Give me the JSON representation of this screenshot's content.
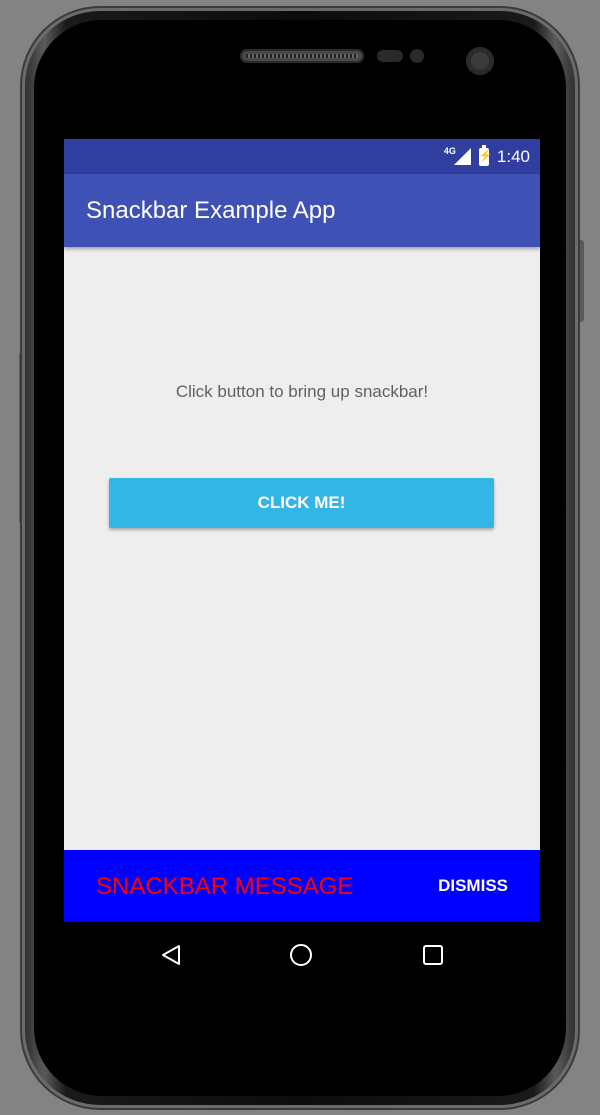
{
  "status_bar": {
    "network": "4G",
    "time": "1:40",
    "background_color": "#303F9F"
  },
  "app_bar": {
    "title": "Snackbar Example App",
    "background_color": "#3F51B5"
  },
  "content": {
    "prompt_text": "Click button to bring up snackbar!",
    "button_label": "CLICK ME!",
    "button_color": "#33B5E5",
    "background_color": "#EEEEEE"
  },
  "snackbar": {
    "message": "SNACKBAR MESSAGE",
    "action_label": "DISMISS",
    "background_color": "#0000FF",
    "message_color": "#FF0000"
  },
  "nav_bar": {
    "buttons": [
      "back-icon",
      "home-icon",
      "recent-apps-icon"
    ]
  }
}
